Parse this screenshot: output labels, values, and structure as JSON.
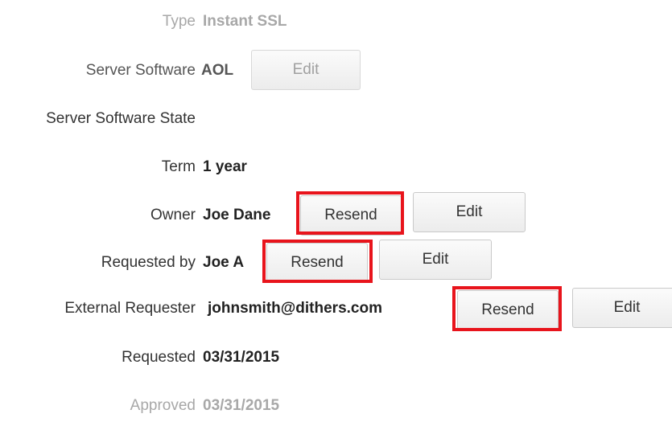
{
  "rows": {
    "type": {
      "label": "Type",
      "value": "Instant SSL"
    },
    "server_software": {
      "label": "Server Software",
      "value": "AOL",
      "edit_label": "Edit"
    },
    "server_software_state": {
      "label": "Server Software State"
    },
    "term": {
      "label": "Term",
      "value": "1 year"
    },
    "owner": {
      "label": "Owner",
      "value": "Joe Dane",
      "resend_label": "Resend",
      "edit_label": "Edit"
    },
    "requested_by": {
      "label": "Requested by",
      "value": "Joe A",
      "resend_label": "Resend",
      "edit_label": "Edit"
    },
    "external_requester": {
      "label": "External Requester",
      "value": "johnsmith@dithers.com",
      "resend_label": "Resend",
      "edit_label": "Edit"
    },
    "requested": {
      "label": "Requested",
      "value": "03/31/2015"
    },
    "approved": {
      "label": "Approved",
      "value": "03/31/2015"
    }
  },
  "highlight_color": "#e8141c"
}
